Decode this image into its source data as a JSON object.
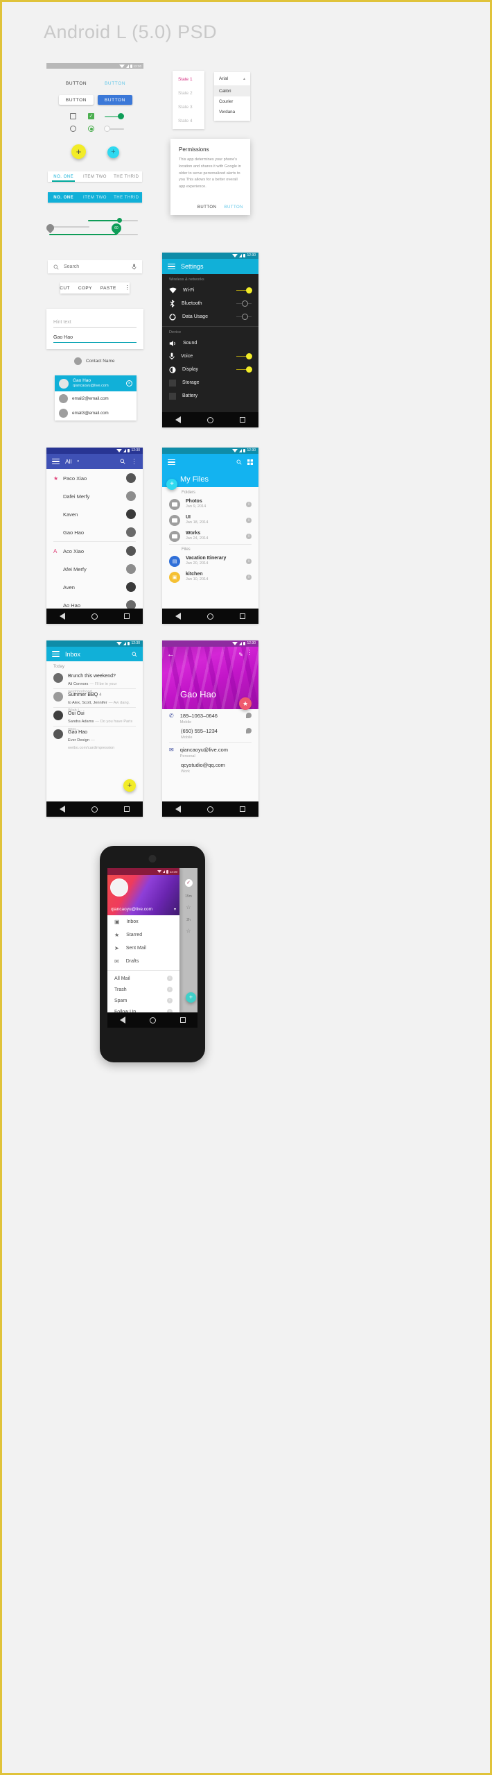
{
  "page": {
    "title": "Android L (5.0) PSD",
    "accent_cyan": "#11b0d8",
    "accent_teal": "#00a99d",
    "accent_yellow": "#f2ec28",
    "accent_green": "#4caf50",
    "accent_blue": "#3b78d8",
    "accent_pink": "#e0457b",
    "accent_indigo": "#3f51b5",
    "accent_magenta": "#c2139a",
    "dark_bg": "#212121",
    "status_time": "12:30"
  },
  "components": {
    "buttons": {
      "flat_dark": "BUTTON",
      "flat_light": "BUTTON",
      "raised_white": "BUTTON",
      "raised_blue": "BUTTON"
    },
    "tabs_light": [
      {
        "label": "NO. ONE",
        "active": true
      },
      {
        "label": "ITEM TWO",
        "active": false
      },
      {
        "label": "THE THRID",
        "active": false
      }
    ],
    "tabs_dark": [
      {
        "label": "NO. ONE",
        "active": true
      },
      {
        "label": "ITEM TWO",
        "active": false
      },
      {
        "label": "THE THRID",
        "active": false
      }
    ],
    "slider_pin_value": "60",
    "search": {
      "value": "",
      "placeholder": "Search"
    },
    "context_menu": [
      "CUT",
      "COPY",
      "PASTE"
    ],
    "text_fields": {
      "hint": "Hint text",
      "filled_value": "Gao Hao"
    },
    "contact_chip": {
      "label": "Contact Name"
    },
    "chip_list": [
      {
        "name": "Gao Hao",
        "email": "qiancaoyu@live.com",
        "selected": true
      },
      {
        "name": "",
        "email": "email2@email.com",
        "selected": false
      },
      {
        "name": "",
        "email": "email3@email.com",
        "selected": false
      }
    ]
  },
  "state_list": {
    "items": [
      {
        "label": "State 1",
        "active": true
      },
      {
        "label": "State 2",
        "active": false
      },
      {
        "label": "State 3",
        "active": false
      },
      {
        "label": "State 4",
        "active": false
      }
    ]
  },
  "font_dropdown": {
    "selected": "Arial",
    "options": [
      "Calibri",
      "Courier",
      "Verdana"
    ],
    "highlighted": "Calibri"
  },
  "permissions_dialog": {
    "title": "Permissions",
    "body": "This app determines your phone's location and shares it with Google in older to serve personalized alerts to you This allows for a better overall app experience.",
    "cancel_label": "BUTTON",
    "confirm_label": "BUTTON"
  },
  "settings_screen": {
    "title": "Settings",
    "sections": [
      {
        "header": "Wireless & networks",
        "rows": [
          {
            "label": "Wi-Fi",
            "icon": "wifi-icon",
            "toggle": "on"
          },
          {
            "label": "Bluetooth",
            "icon": "bluetooth-icon",
            "toggle": "off"
          },
          {
            "label": "Data Usage",
            "icon": "data-usage-icon",
            "toggle": "off"
          }
        ]
      },
      {
        "header": "Device",
        "rows": [
          {
            "label": "Sound",
            "icon": "sound-icon",
            "toggle": "none"
          },
          {
            "label": "Voice",
            "icon": "mic-icon",
            "toggle": "on"
          },
          {
            "label": "Display",
            "icon": "brightness-icon",
            "toggle": "on"
          },
          {
            "label": "Storage",
            "icon": "storage-icon",
            "toggle": "none"
          },
          {
            "label": "Battery",
            "icon": "battery-icon",
            "toggle": "none"
          }
        ]
      }
    ]
  },
  "contacts_screen": {
    "title": "All",
    "groups": [
      {
        "index": "★",
        "rows": [
          "Paco Xiao",
          "Dafei Merfy",
          "Kaven",
          "Gao Hao"
        ]
      },
      {
        "index": "A",
        "rows": [
          "Aco Xiao",
          "Afei Merfy",
          "Aven",
          "Ao Hao"
        ]
      }
    ]
  },
  "files_screen": {
    "title": "My Files",
    "sections": [
      {
        "header": "Folders",
        "items": [
          {
            "name": "Photos",
            "date": "Jan 9, 2014",
            "kind": "folder"
          },
          {
            "name": "UI",
            "date": "Jan 18, 2014",
            "kind": "folder"
          },
          {
            "name": "Works",
            "date": "Jan 24, 2014",
            "kind": "folder"
          }
        ]
      },
      {
        "header": "Files",
        "items": [
          {
            "name": "Vacation Itinerary",
            "date": "Jan 20, 2014",
            "kind": "doc"
          },
          {
            "name": "kitchen",
            "date": "Jan 10, 2014",
            "kind": "image"
          }
        ]
      }
    ]
  },
  "inbox_screen": {
    "title": "Inbox",
    "section": "Today",
    "messages": [
      {
        "subject": "Brunch this weekend?",
        "count": "",
        "sender": "Ali Connors",
        "preview": "I'll be in your neighborhood ..."
      },
      {
        "subject": "Summer BBQ",
        "count": "4",
        "sender": "to Alex, Scott, Jennifer",
        "preview": "Aw dang. Wish I..."
      },
      {
        "subject": "Oui Oui",
        "count": "",
        "sender": "Sandra Adams",
        "preview": "Do you have Paris reco..."
      },
      {
        "subject": "Gao Hao",
        "count": "",
        "sender": "Ever Design",
        "preview": "weibo.com/cardimpression"
      }
    ]
  },
  "profile_screen": {
    "name": "Gao Hao",
    "entries": [
      {
        "icon": "phone-icon",
        "value": "189–1063–0646",
        "label": "Mobile",
        "action": "message-icon"
      },
      {
        "icon": "",
        "value": "(650) 555–1234",
        "label": "Mobile",
        "action": "message-icon"
      },
      {
        "icon": "mail-icon",
        "value": "qiancaoyu@live.com",
        "label": "Personal",
        "action": ""
      },
      {
        "icon": "",
        "value": "qcystudio@qq.com",
        "label": "Work",
        "action": ""
      }
    ]
  },
  "device_mockup": {
    "account_email": "qiancaoyu@live.com",
    "drawer_primary": [
      {
        "label": "Inbox",
        "icon": "inbox-icon"
      },
      {
        "label": "Starred",
        "icon": "star-icon"
      },
      {
        "label": "Sent Mail",
        "icon": "send-icon"
      },
      {
        "label": "Drafts",
        "icon": "drafts-icon"
      }
    ],
    "drawer_secondary": [
      {
        "label": "All Mail",
        "count": ""
      },
      {
        "label": "Trash",
        "count": ""
      },
      {
        "label": "Spam",
        "count": ""
      },
      {
        "label": "Follow Up",
        "count": ""
      }
    ],
    "behind_list": [
      "15m",
      "2h"
    ]
  }
}
